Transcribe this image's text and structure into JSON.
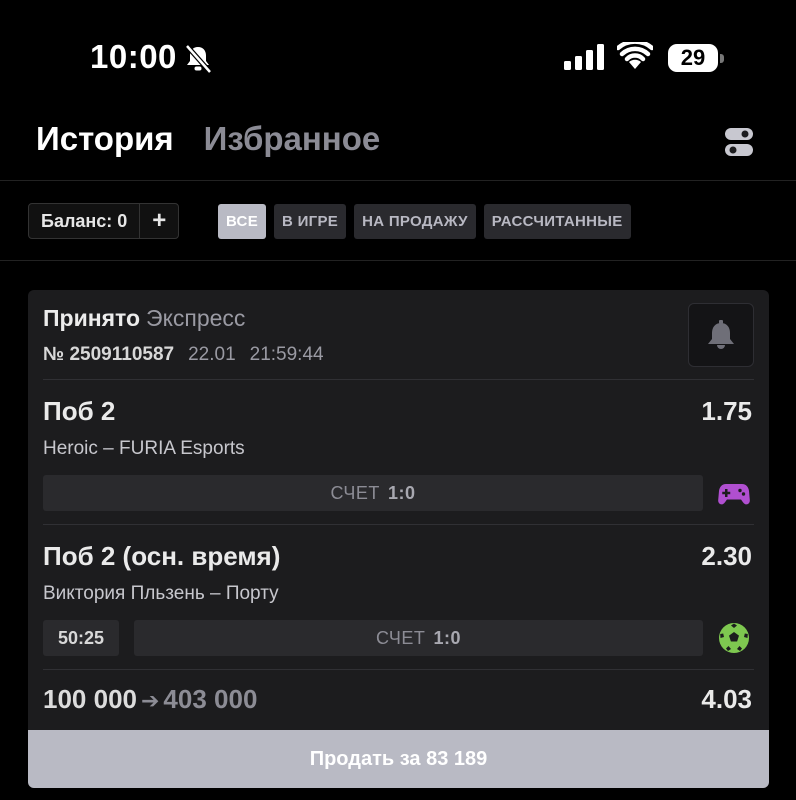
{
  "status_bar": {
    "time": "10:00",
    "battery": "29"
  },
  "tabs": [
    {
      "label": "История",
      "active": true
    },
    {
      "label": "Избранное",
      "active": false
    }
  ],
  "balance": {
    "label": "Баланс: 0",
    "add": "+"
  },
  "filters": [
    {
      "label": "ВСЕ",
      "active": true
    },
    {
      "label": "В ИГРЕ",
      "active": false
    },
    {
      "label": "НА ПРОДАЖУ",
      "active": false
    },
    {
      "label": "РАССЧИТАННЫЕ",
      "active": false
    }
  ],
  "bet": {
    "status": "Принято",
    "type": "Экспресс",
    "number_prefix": "№",
    "number": "2509110587",
    "date": "22.01",
    "time": "21:59:44",
    "selections": [
      {
        "title": "Поб 2",
        "odds": "1.75",
        "teams": "Heroic – FURIA Esports",
        "score_label": "СЧЕТ",
        "score": "1:0",
        "sport_icon": "gamepad-icon",
        "live_time": ""
      },
      {
        "title": "Поб 2 (осн. время)",
        "odds": "2.30",
        "teams": "Виктория Пльзень – Порту",
        "score_label": "СЧЕТ",
        "score": "1:0",
        "sport_icon": "soccer-ball-icon",
        "live_time": "50:25"
      }
    ],
    "stake": "100 000",
    "arrow": "➔",
    "potential_win": "403 000",
    "total_odds": "4.03",
    "sell_label": "Продать за 83 189"
  },
  "colors": {
    "background": "#000000",
    "card": "#1c1c1e",
    "accent_button": "#b9bac4",
    "esports_icon": "#b04fd0",
    "soccer_icon": "#7ec850"
  }
}
